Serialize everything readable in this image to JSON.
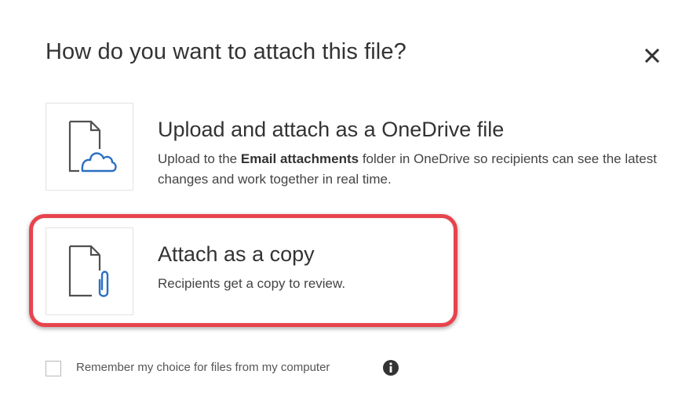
{
  "dialog": {
    "title": "How do you want to attach this file?",
    "close_icon": "close-icon"
  },
  "options": [
    {
      "icon": "file-cloud-icon",
      "title": "Upload and attach as a OneDrive file",
      "desc_prefix": "Upload to the ",
      "desc_bold": "Email attachments",
      "desc_suffix": " folder in OneDrive so recipients can see the latest changes and work together in real time."
    },
    {
      "icon": "file-paperclip-icon",
      "title": "Attach as a copy",
      "description": "Recipients get a copy to review."
    }
  ],
  "remember": {
    "checked": false,
    "label": "Remember my choice for files from my computer",
    "info_icon": "info-icon"
  },
  "colors": {
    "highlight": "#e8434c",
    "icon_blue": "#2b6fc2",
    "icon_gray": "#505050"
  }
}
